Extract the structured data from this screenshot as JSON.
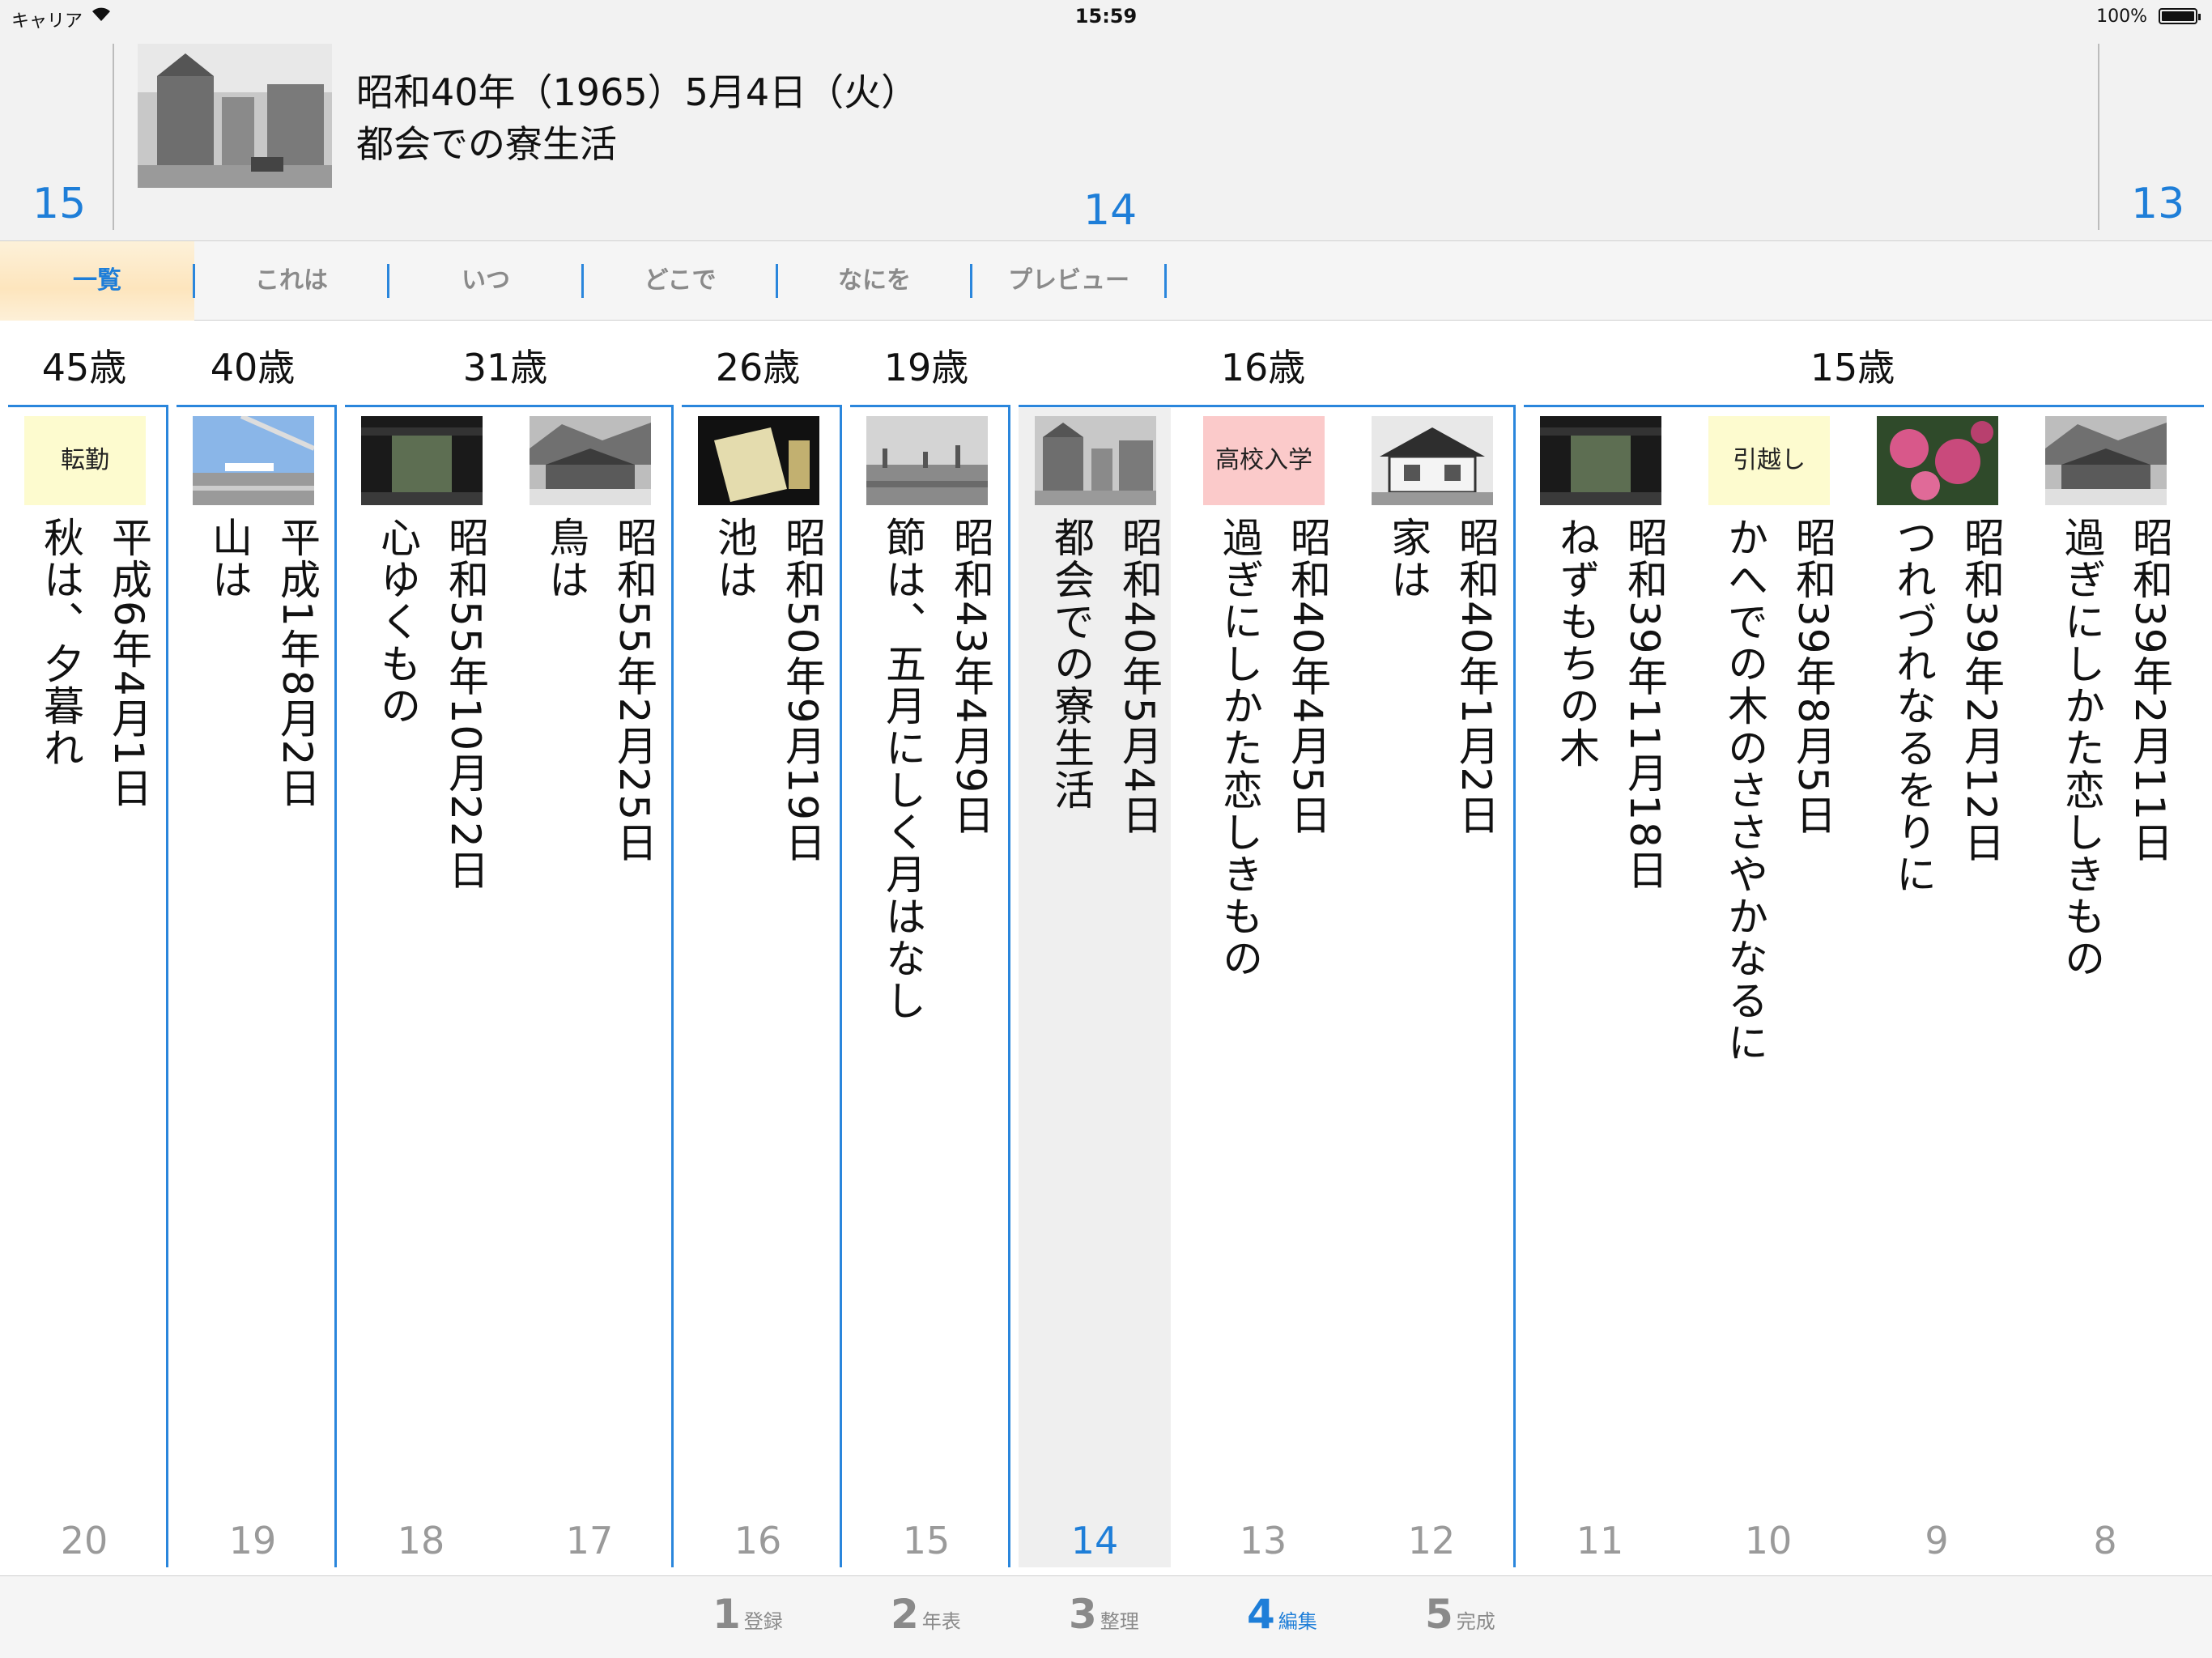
{
  "status": {
    "carrier": "キャリア",
    "time": "15:59",
    "battery": "100%"
  },
  "header": {
    "prev_num": "15",
    "current_num": "14",
    "next_num": "13",
    "date": "昭和40年（1965）5月4日（火）",
    "title": "都会での寮生活"
  },
  "tabs": [
    {
      "label": "一覧",
      "active": true
    },
    {
      "label": "これは"
    },
    {
      "label": "いつ"
    },
    {
      "label": "どこで"
    },
    {
      "label": "なにを"
    },
    {
      "label": "プレビュー"
    }
  ],
  "ages": [
    "45歳",
    "40歳",
    "31歳",
    "26歳",
    "19歳",
    "16歳",
    "15歳"
  ],
  "columns": [
    {
      "num": "20",
      "tag": "転勤",
      "date": "平成6年4月1日",
      "phrase": "秋は、夕暮れ"
    },
    {
      "num": "19",
      "thumb": "airport-photo",
      "date": "平成1年8月2日",
      "phrase": "山は"
    },
    {
      "num": "18",
      "thumb": "gate-photo",
      "date": "昭和55年10月22日",
      "phrase": "心ゆくもの"
    },
    {
      "num": "17",
      "thumb": "village-photo",
      "date": "昭和55年2月25日",
      "phrase": "鳥は"
    },
    {
      "num": "16",
      "thumb": "notebook-photo",
      "date": "昭和50年9月19日",
      "phrase": "池は"
    },
    {
      "num": "15",
      "thumb": "factory-photo",
      "date": "昭和43年4月9日",
      "phrase": "節は、五月にしく月はなし"
    },
    {
      "num": "14",
      "thumb": "street-photo",
      "date": "昭和40年5月4日",
      "phrase": "都会での寮生活",
      "selected": true
    },
    {
      "num": "13",
      "tag": "高校入学",
      "date": "昭和40年4月5日",
      "phrase": "過ぎにしかた恋しきもの"
    },
    {
      "num": "12",
      "thumb": "house-photo",
      "date": "昭和40年1月2日",
      "phrase": "家は"
    },
    {
      "num": "11",
      "thumb": "gate-photo",
      "date": "昭和39年11月18日",
      "phrase": "ねずもちの木"
    },
    {
      "num": "10",
      "tag": "引越し",
      "date": "昭和39年8月5日",
      "phrase": "かへでの木のささやかなるに"
    },
    {
      "num": "9",
      "thumb": "flower-photo",
      "date": "昭和39年2月12日",
      "phrase": "つれづれなるをりに"
    },
    {
      "num": "8",
      "thumb": "village-photo",
      "date": "昭和39年2月11日",
      "phrase": "過ぎにしかた恋しきもの"
    }
  ],
  "steps": [
    {
      "n": "1",
      "label": "登録"
    },
    {
      "n": "2",
      "label": "年表"
    },
    {
      "n": "3",
      "label": "整理"
    },
    {
      "n": "4",
      "label": "編集",
      "active": true
    },
    {
      "n": "5",
      "label": "完成"
    }
  ],
  "colors": {
    "accent": "#1e7ed8",
    "tag_yellow": "#fdfbcf",
    "tag_pink": "#fbcaca",
    "selected_bg": "#efefef"
  }
}
